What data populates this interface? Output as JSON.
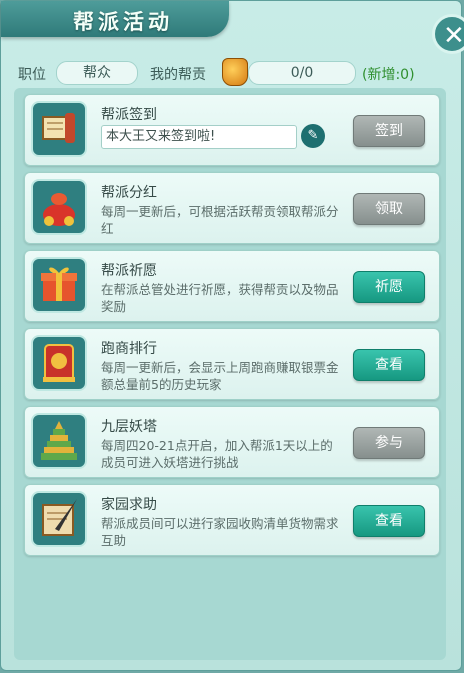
{
  "window": {
    "title": "帮派活动",
    "close_glyph": "✕"
  },
  "info": {
    "position_label": "职位",
    "position_value": "帮众",
    "contribution_label": "我的帮贡",
    "contribution_value": "0/0",
    "new_added": "(新增:0)",
    "contribution_icon": "coin-bag-icon"
  },
  "activities": [
    {
      "title": "帮派签到",
      "desc": "",
      "input": "本大王又来签到啦!",
      "button": "签到",
      "button_state": "disabled",
      "icon": "scroll-book-icon"
    },
    {
      "title": "帮派分红",
      "desc": "每周一更新后，可根据活跃帮贡领取帮派分红",
      "button": "领取",
      "button_state": "disabled",
      "icon": "treasure-bag-icon"
    },
    {
      "title": "帮派祈愿",
      "desc": "在帮派总管处进行祈愿，获得帮贡以及物品奖励",
      "button": "祈愿",
      "button_state": "active",
      "icon": "gift-box-icon"
    },
    {
      "title": "跑商排行",
      "desc": "每周一更新后，会显示上周跑商赚取银票金额总量前5的历史玩家",
      "button": "查看",
      "button_state": "active",
      "icon": "ranking-banner-icon"
    },
    {
      "title": "九层妖塔",
      "desc": "每周四20-21点开启，加入帮派1天以上的成员可进入妖塔进行挑战",
      "button": "参与",
      "button_state": "disabled",
      "icon": "pagoda-icon"
    },
    {
      "title": "家园求助",
      "desc": "帮派成员间可以进行家园收购清单货物需求互助",
      "button": "查看",
      "button_state": "active",
      "icon": "quill-scroll-icon"
    }
  ],
  "colors": {
    "accent": "#169881",
    "disabled": "#868f8d",
    "panel": "#c8ece7"
  }
}
